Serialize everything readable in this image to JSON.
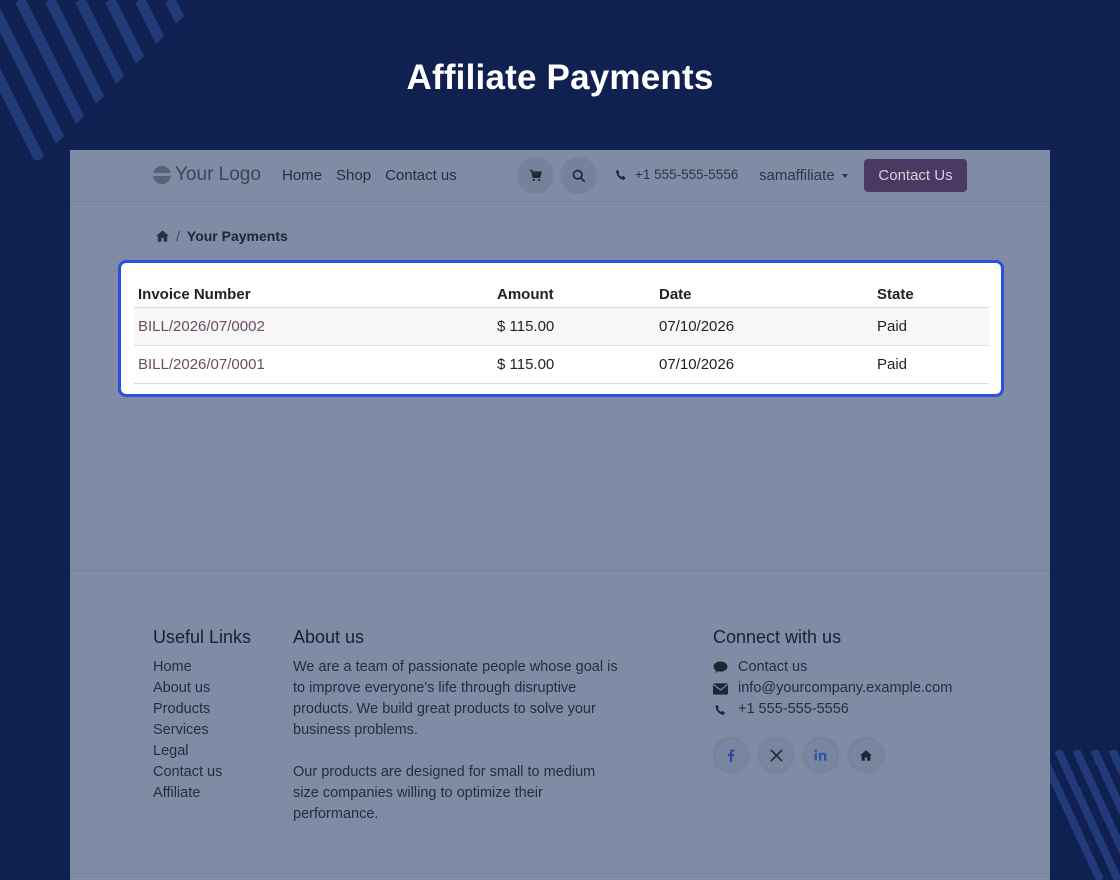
{
  "hero": {
    "title": "Affiliate Payments"
  },
  "colors": {
    "background": "#102050",
    "accent_button": "#4a3a63",
    "highlight_border": "#2b4fe0",
    "invoice_link": "#6d4b63"
  },
  "navbar": {
    "logo": "Your Logo",
    "links": [
      "Home",
      "Shop",
      "Contact us"
    ],
    "icons": [
      "cart-icon",
      "search-icon"
    ],
    "phone": "+1 555-555-5556",
    "user": "samaffiliate",
    "cta": "Contact Us"
  },
  "breadcrumb": {
    "home_icon": "home-icon",
    "current": "Your Payments"
  },
  "payments_table": {
    "headers": [
      "Invoice Number",
      "Amount",
      "Date",
      "State"
    ],
    "rows": [
      [
        "BILL/2026/07/0002",
        "$ 115.00",
        "07/10/2026",
        "Paid"
      ],
      [
        "BILL/2026/07/0001",
        "$ 115.00",
        "07/10/2026",
        "Paid"
      ]
    ]
  },
  "footer": {
    "useful_links": {
      "title": "Useful Links",
      "items": [
        "Home",
        "About us",
        "Products",
        "Services",
        "Legal",
        "Contact us",
        "Affiliate"
      ]
    },
    "about": {
      "title": "About us",
      "p1": "We are a team of passionate people whose goal is to improve everyone's life through disruptive products. We build great products to solve your business problems.",
      "p2": "Our products are designed for small to medium size companies willing to optimize their performance."
    },
    "connect": {
      "title": "Connect with us",
      "contact": "Contact us",
      "email": "info@yourcompany.example.com",
      "phone": "+1 555-555-5556",
      "socials": [
        "facebook-icon",
        "x-twitter-icon",
        "linkedin-icon",
        "home-icon"
      ]
    }
  }
}
